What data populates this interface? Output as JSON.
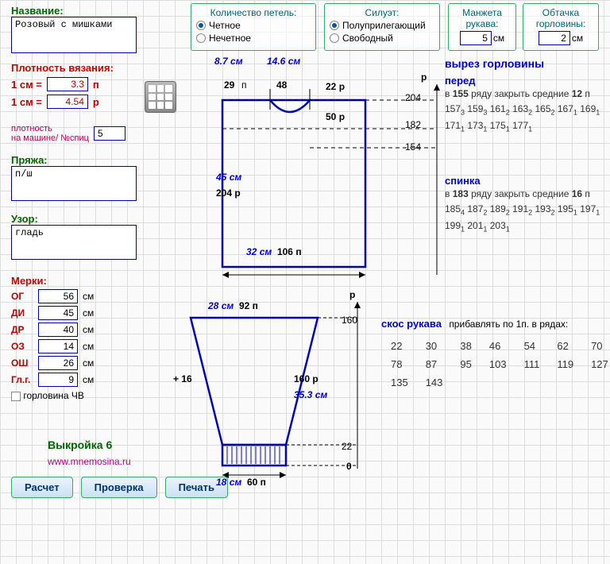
{
  "header": {
    "name_label": "Название:",
    "name_value": "Розовый с мишками",
    "loops_title": "Количество петель:",
    "loops_opt1": "Четное",
    "loops_opt2": "Нечетное",
    "silhouette_title": "Силуэт:",
    "sil_opt1": "Полуприлегающий",
    "sil_opt2": "Свободный",
    "cuff_title": "Манжета\nрукава:",
    "cuff_value": "5",
    "cuff_unit": "см",
    "neck_title": "Обтачка\nгорловины:",
    "neck_value": "2",
    "neck_unit": "см"
  },
  "density": {
    "title": "Плотность вязания:",
    "row1_lhs": "1 см =",
    "row1_val": "3.3",
    "row1_unit": "п",
    "row2_lhs": "1 см =",
    "row2_val": "4.54",
    "row2_unit": "р",
    "machine_label": "плотность\nна машине/ №спиц",
    "machine_val": "5"
  },
  "yarn": {
    "title": "Пряжа:",
    "value": "п/ш"
  },
  "pattern": {
    "title": "Узор:",
    "value": "гладь"
  },
  "measurements": {
    "title": "Мерки:",
    "items": [
      {
        "label": "ОГ",
        "value": "56",
        "unit": "см"
      },
      {
        "label": "ДИ",
        "value": "45",
        "unit": "см"
      },
      {
        "label": "ДР",
        "value": "40",
        "unit": "см"
      },
      {
        "label": "ОЗ",
        "value": "14",
        "unit": "см"
      },
      {
        "label": "ОШ",
        "value": "26",
        "unit": "см"
      },
      {
        "label": "Гл.г.",
        "value": "9",
        "unit": "см"
      }
    ],
    "collar_checkbox": "горловина ЧВ"
  },
  "footer": {
    "pattern_num": "Выкройка 6",
    "url": "www.mnemosina.ru",
    "btn_calc": "Расчет",
    "btn_check": "Проверка",
    "btn_print": "Печать"
  },
  "bodice": {
    "top_left_cm": "8.7",
    "top_right_cm": "14.6",
    "top_left_st": "29",
    "top_right_st": "48",
    "right22": "22",
    "right50": "50",
    "r204": "204",
    "r182": "182",
    "r154": "154",
    "height_cm": "45",
    "height_rows": "204",
    "bottom_cm": "32",
    "bottom_st": "106",
    "p_units": "п",
    "r_units": "р",
    "cm_units": "см"
  },
  "neckline": {
    "title": "вырез горловины",
    "front_label": "перед",
    "front_intro_pre": "в",
    "front_intro_row": "155",
    "front_intro_txt": "ряду закрыть средние",
    "front_intro_st": "12",
    "front_intro_suf": "п",
    "front_chain": "157₃ 159₃ 161₂ 163₂ 165₂ 167₁ 169₁ 171₁ 173₁ 175₁ 177₁",
    "back_label": "спинка",
    "back_intro_row": "183",
    "back_intro_txt": "ряду закрыть средние",
    "back_intro_st": "16",
    "back_chain": "185₄ 187₂ 189₂ 191₂ 193₂ 195₁ 197₁ 199₁ 201₁ 203₁"
  },
  "sleeve": {
    "top_cm": "28",
    "top_st": "92",
    "r160": "160",
    "r22": "22",
    "r0": "0",
    "height_rows": "160",
    "height_cm": "35.3",
    "plus": "+ 16",
    "bot_cm": "18",
    "bot_st": "60",
    "skos_title": "скос рукава",
    "skos_note": "прибавлять по 1п. в рядах:",
    "rows": [
      "22",
      "30",
      "38",
      "46",
      "54",
      "62",
      "70",
      "78",
      "87",
      "95",
      "103",
      "111",
      "119",
      "127",
      "135",
      "143"
    ]
  }
}
